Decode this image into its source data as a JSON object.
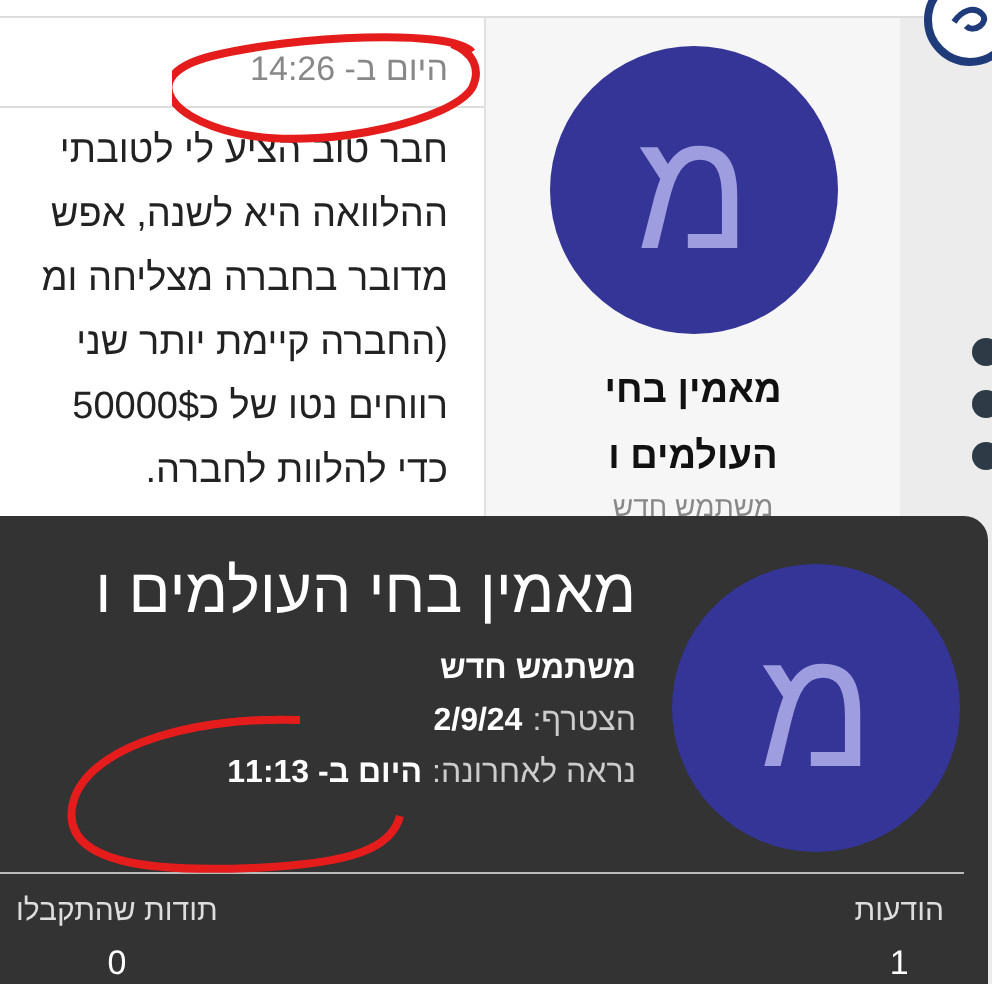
{
  "post": {
    "timestamp": "היום ב- 14:26",
    "lines": [
      "חבר טוב הציע לי לטובתי",
      "ההלוואה היא לשנה, אפש",
      "מדובר בחברה מצליחה ומ",
      "(החברה קיימת יותר שני",
      "רווחים נטו של כ50000$",
      "כדי להלוות לחברה."
    ]
  },
  "author": {
    "avatar_letter": "מ",
    "name": "מאמין בחי העולמים ו",
    "role": "משתמש חדש"
  },
  "popup": {
    "avatar_letter": "מ",
    "name": "מאמין בחי העולמים ו",
    "role": "משתמש חדש",
    "joined_label": "הצטרף:",
    "joined": "2/9/24",
    "last_seen_label": "נראה לאחרונה:",
    "last_seen": "היום ב- 11:13",
    "stats": [
      {
        "label": "הודעות",
        "value": "1"
      },
      {
        "label": "תודות שהתקבלו",
        "value": "0"
      }
    ]
  }
}
